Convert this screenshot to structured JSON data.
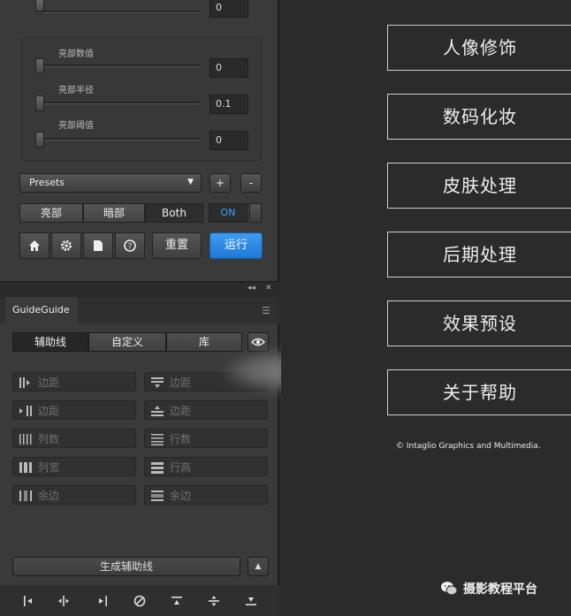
{
  "top_panel": {
    "first_value": "0",
    "sliders": [
      {
        "label": "亮部数值",
        "value": "0"
      },
      {
        "label": "亮部半径",
        "value": "0.1"
      },
      {
        "label": "亮部阈值",
        "value": "0"
      }
    ],
    "presets_label": "Presets",
    "plus_label": "+",
    "minus_label": "-",
    "segments": [
      "亮部",
      "暗部",
      "Both"
    ],
    "on_label": "ON",
    "reset_label": "重置",
    "run_label": "运行"
  },
  "guideguide": {
    "tab_title": "GuideGuide",
    "modes": [
      "辅助线",
      "自定义",
      "库"
    ],
    "fields": [
      {
        "label": "边距",
        "icon": "left-margin-icon"
      },
      {
        "label": "边距",
        "icon": "top-margin-icon"
      },
      {
        "label": "边距",
        "icon": "right-margin-icon"
      },
      {
        "label": "边距",
        "icon": "bottom-margin-icon"
      },
      {
        "label": "列数",
        "icon": "columns-icon"
      },
      {
        "label": "行数",
        "icon": "rows-icon"
      },
      {
        "label": "列宽",
        "icon": "column-width-icon"
      },
      {
        "label": "行高",
        "icon": "row-height-icon"
      },
      {
        "label": "余边",
        "icon": "column-gutter-icon"
      },
      {
        "label": "余边",
        "icon": "row-gutter-icon"
      }
    ],
    "generate_label": "生成辅助线"
  },
  "menu": {
    "items": [
      "人像修饰",
      "数码化妆",
      "皮肤处理",
      "后期处理",
      "效果预设",
      "关于帮助"
    ],
    "copyright": "© Intaglio Graphics and Multimedia."
  },
  "watermark": {
    "text": "摄影教程平台"
  },
  "colors": {
    "accent": "#2a88e6",
    "on_text": "#3aa3ff"
  }
}
